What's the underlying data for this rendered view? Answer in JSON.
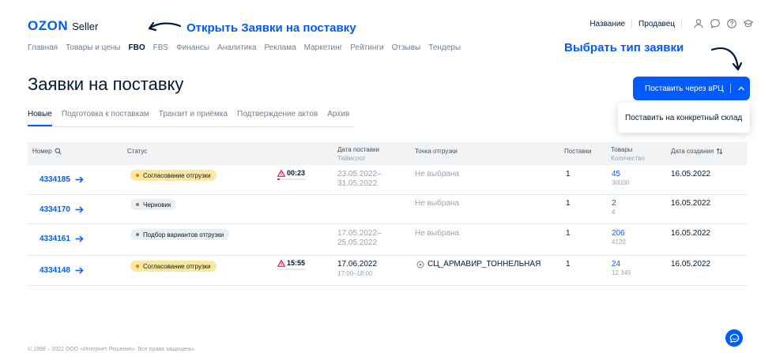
{
  "header": {
    "logo_brand": "OZON",
    "logo_suffix": "Seller",
    "nav": [
      "Главная",
      "Товары и цены",
      "FBO",
      "FBS",
      "Финансы",
      "Аналитика",
      "Реклама",
      "Маркетинг",
      "Рейтинги",
      "Отзывы",
      "Тендеры"
    ],
    "company_label": "Название",
    "role_label": "Продавец",
    "icons": [
      "user-icon",
      "chat-icon",
      "help-icon",
      "education-icon"
    ]
  },
  "annotations": {
    "open_requests": "Открыть Заявки на поставку",
    "choose_type": "Выбрать тип заявки"
  },
  "page": {
    "title": "Заявки на поставку",
    "tabs": [
      "Новые",
      "Подготовка к поставкам",
      "Транзит и приёмка",
      "Подтверждение актов",
      "Архив"
    ],
    "primary_button": "Поставить через вРЦ",
    "dropdown_item": "Поставить на конкретный склад"
  },
  "table": {
    "headers": {
      "number": "Номер",
      "status": "Статус",
      "date": "Дата поставки",
      "date_sub": "Таймслот",
      "point": "Точка отгрузки",
      "supplies": "Поставки",
      "goods": "Товары",
      "goods_sub": "Количество",
      "created": "Дата создания"
    },
    "rows": [
      {
        "number": "4334185",
        "status": "Согласование отгрузки",
        "timer": "00:23",
        "date": "23.05.2022–",
        "date2": "31.05.2022",
        "point": "Не выбрана",
        "supplies": "1",
        "goods": "45",
        "qty": "30000",
        "created": "16.05.2022"
      },
      {
        "number": "4334170",
        "status": "Черновик",
        "timer": "",
        "date": "",
        "date2": "",
        "point": "Не выбрана",
        "supplies": "1",
        "goods": "2",
        "qty": "4",
        "created": "16.05.2022"
      },
      {
        "number": "4334161",
        "status": "Подбор вариантов отгрузки",
        "timer": "",
        "date": "17.05.2022–",
        "date2": "25.05.2022",
        "point": "Не выбрана",
        "supplies": "1",
        "goods": "206",
        "qty": "4120",
        "created": "16.05.2022"
      },
      {
        "number": "4334148",
        "status": "Согласование отгрузки",
        "timer": "15:55",
        "date": "17.06.2022",
        "date2": "17:00–18:00",
        "point": "СЦ_АРМАВИР_ТОННЕЛЬНАЯ",
        "supplies": "1",
        "goods": "24",
        "qty": "12 345",
        "created": "16.05.2022"
      }
    ]
  },
  "footer": "© 1998 – 2022 ООО «Интернет Решения». Все права защищены.",
  "colors": {
    "accent": "#005bff",
    "warning_badge": "#fde7a0",
    "alert": "#f91155"
  }
}
